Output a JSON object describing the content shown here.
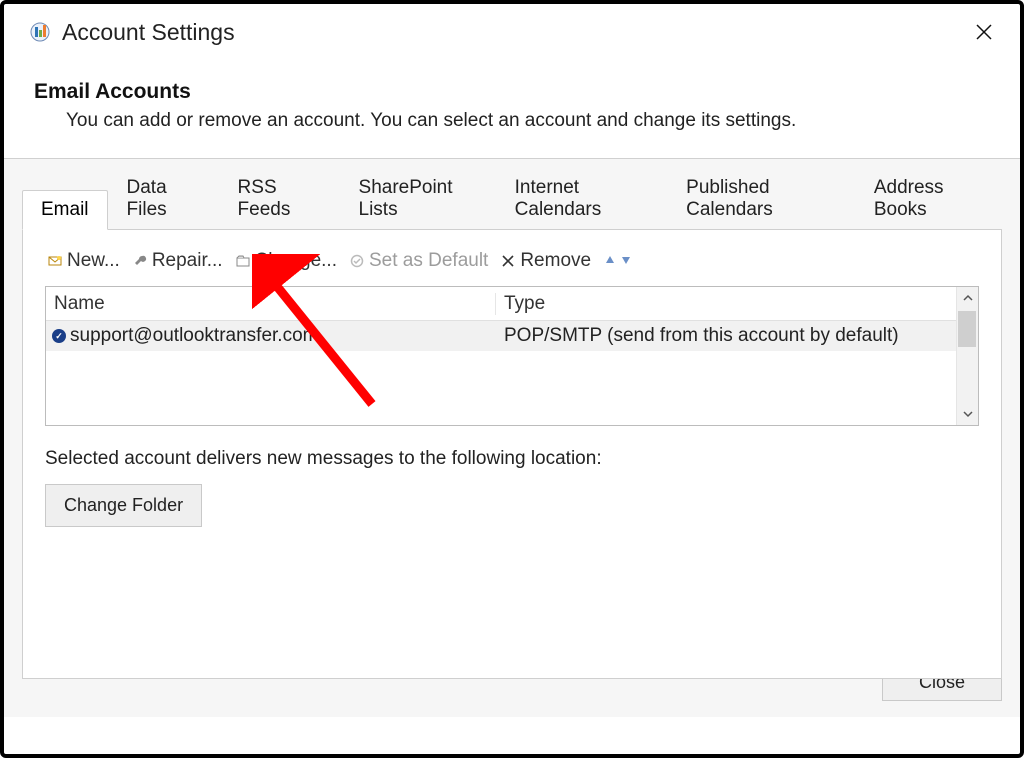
{
  "title": "Account Settings",
  "header": {
    "heading": "Email Accounts",
    "subtext": "You can add or remove an account. You can select an account and change its settings."
  },
  "tabs": [
    {
      "label": "Email",
      "active": true
    },
    {
      "label": "Data Files",
      "active": false
    },
    {
      "label": "RSS Feeds",
      "active": false
    },
    {
      "label": "SharePoint Lists",
      "active": false
    },
    {
      "label": "Internet Calendars",
      "active": false
    },
    {
      "label": "Published Calendars",
      "active": false
    },
    {
      "label": "Address Books",
      "active": false
    }
  ],
  "toolbar": {
    "new_label": "New...",
    "repair_label": "Repair...",
    "change_label": "Change...",
    "default_label": "Set as Default",
    "remove_label": "Remove"
  },
  "columns": {
    "name": "Name",
    "type": "Type"
  },
  "rows": [
    {
      "name": "support@outlooktransfer.com",
      "type": "POP/SMTP (send from this account by default)",
      "is_default": true
    }
  ],
  "deliver_text": "Selected account delivers new messages to the following location:",
  "change_folder_label": "Change Folder",
  "close_label": "Close"
}
